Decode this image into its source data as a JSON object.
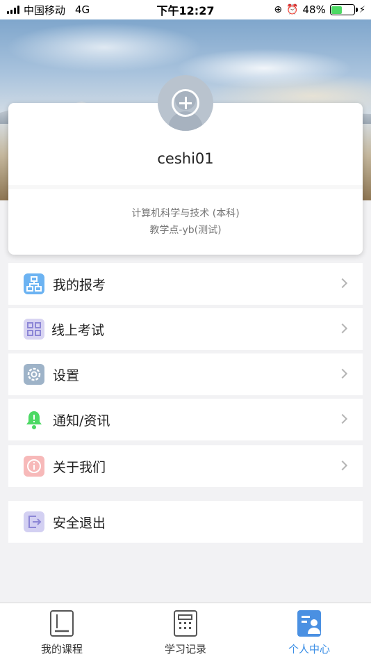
{
  "status_bar": {
    "carrier": "中国移动",
    "network": "4G",
    "time": "下午12:27",
    "battery": "48%",
    "battery_level": 0.48
  },
  "profile": {
    "username": "ceshi01",
    "major": "计算机科学与技术 (本科)",
    "site": "教学点-yb(测试)"
  },
  "menu": {
    "items": [
      {
        "label": "我的报考",
        "icon": "org-chart-icon"
      },
      {
        "label": "线上考试",
        "icon": "grid-icon"
      },
      {
        "label": "设置",
        "icon": "gear-icon"
      },
      {
        "label": "通知/资讯",
        "icon": "bell-icon"
      },
      {
        "label": "关于我们",
        "icon": "info-icon"
      }
    ],
    "logout": {
      "label": "安全退出",
      "icon": "logout-icon"
    }
  },
  "tabbar": {
    "tabs": [
      {
        "label": "我的课程",
        "icon": "book-icon"
      },
      {
        "label": "学习记录",
        "icon": "calculator-icon"
      },
      {
        "label": "个人中心",
        "icon": "profile-icon",
        "active": true
      }
    ]
  },
  "colors": {
    "accent": "#3a8ee6",
    "notice_green": "#4cd964"
  }
}
